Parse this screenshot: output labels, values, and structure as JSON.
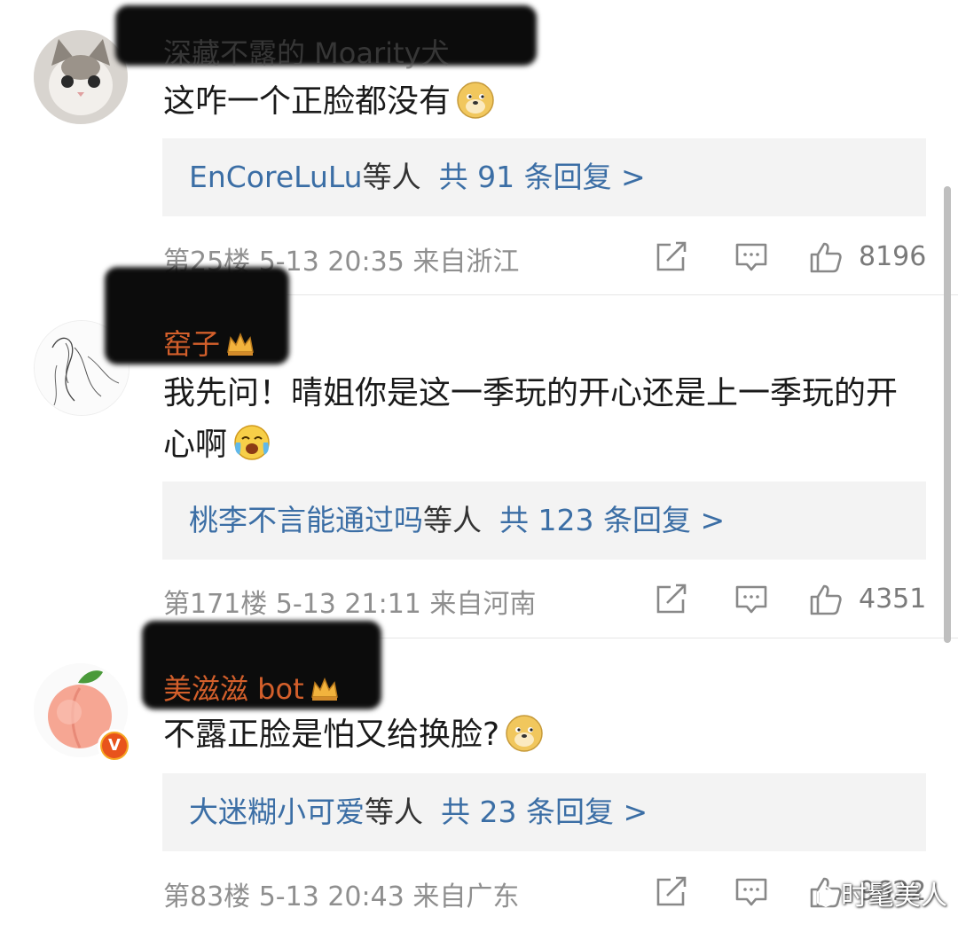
{
  "comments": [
    {
      "username": "深藏不露的 Moarity犬",
      "text": "这咋一个正脸都没有",
      "emoji": "doge-emoji",
      "reply_names": "EnCoreLuLu",
      "reply_mid": "等人",
      "reply_count": "共 91 条回复 >",
      "meta": "第25楼  5-13 20:35  来自浙江",
      "likes": "8196"
    },
    {
      "username": "窑子",
      "text": "我先问！晴姐你是这一季玩的开心还是上一季玩的开心啊",
      "emoji": "crying-laugh-emoji",
      "reply_names": "桃李不言能通过吗",
      "reply_mid": "等人",
      "reply_count": "共 123 条回复 >",
      "meta": "第171楼  5-13 21:11  来自河南",
      "likes": "4351"
    },
    {
      "username": "美滋滋 bot",
      "text": "不露正脸是怕又给换脸?",
      "emoji": "doge-emoji",
      "reply_names": "大迷糊小可爱",
      "reply_mid": "等人",
      "reply_count": "共 23 条回复 >",
      "meta": "第83楼  5-13 20:43  来自广东",
      "likes": "9622",
      "verified_badge": "V"
    }
  ],
  "watermark": "时髦美人",
  "colors": {
    "link": "#3b6ea5",
    "username": "#d35f2b",
    "meta": "#8f8f8f",
    "reply_bg": "#f3f3f3"
  }
}
